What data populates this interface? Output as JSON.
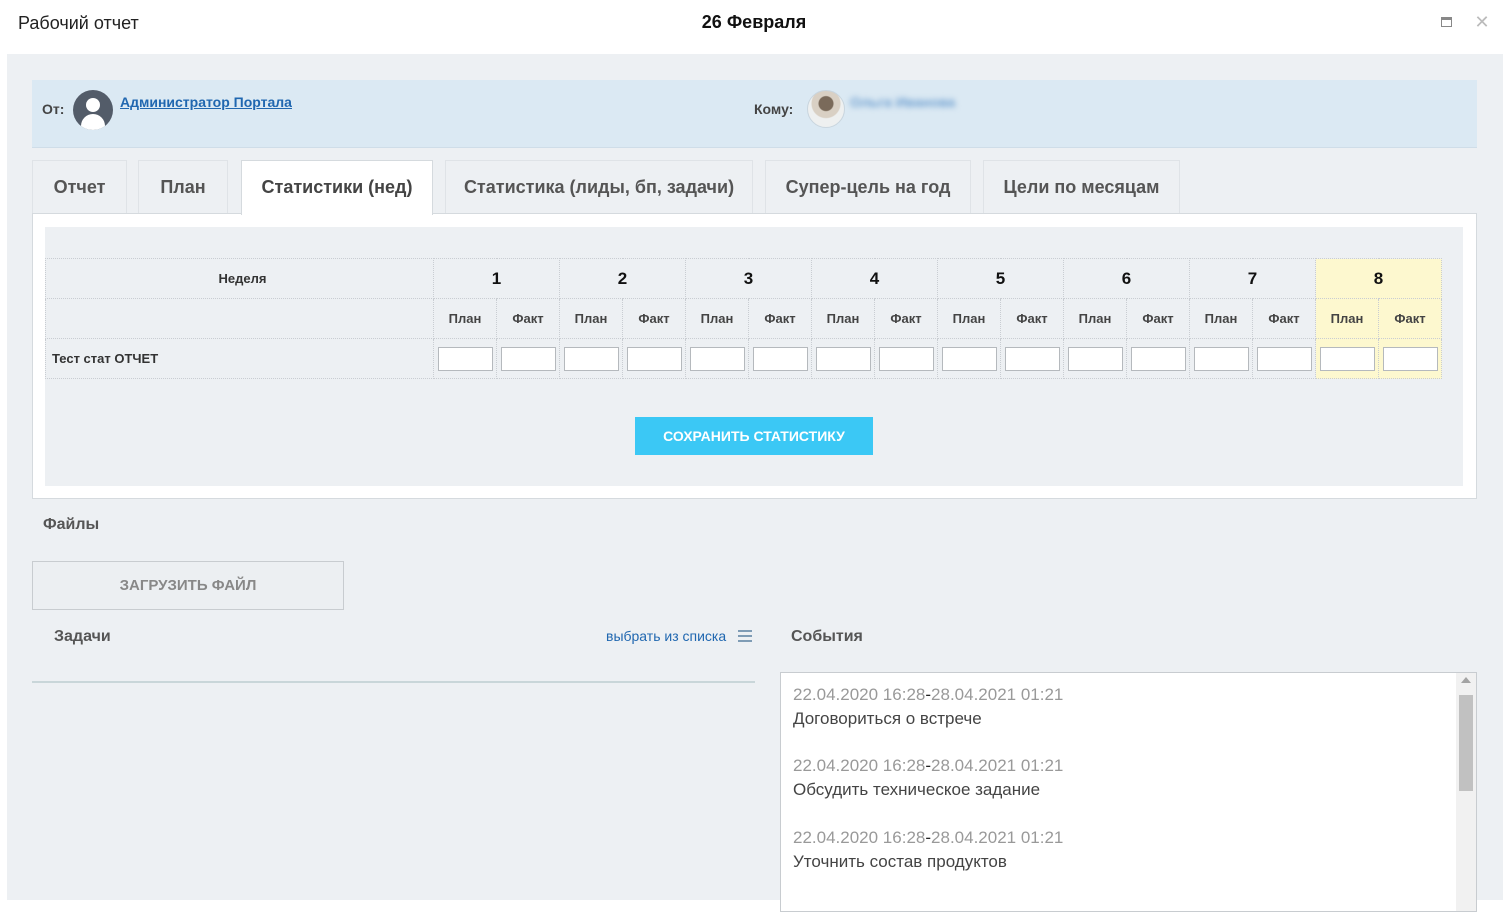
{
  "window": {
    "title": "Рабочий отчет",
    "date": "26 Февраля",
    "maximize_icon": "maximize-icon",
    "close_glyph": "✕"
  },
  "header": {
    "from_label": "От:",
    "from_name": "Администратор Портала",
    "to_label": "Кому:",
    "to_name": "Ольга Иванова"
  },
  "tabs": [
    {
      "label": "Отчет",
      "active": false
    },
    {
      "label": "План",
      "active": false
    },
    {
      "label": "Статистики (нед)",
      "active": true
    },
    {
      "label": "Статистика (лиды, бп, задачи)",
      "active": false
    },
    {
      "label": "Супер-цель на год",
      "active": false
    },
    {
      "label": "Цели по месяцам",
      "active": false
    }
  ],
  "stats": {
    "week_label": "Неделя",
    "weeks": [
      "1",
      "2",
      "3",
      "4",
      "5",
      "6",
      "7",
      "8"
    ],
    "plan_label": "План",
    "fact_label": "Факт",
    "highlighted_week": "8",
    "highlight_color": "#fdf8cf",
    "rows": [
      {
        "name": "Тест стат ОТЧЕТ",
        "values": [
          "",
          "",
          "",
          "",
          "",
          "",
          "",
          "",
          "",
          "",
          "",
          "",
          "",
          "",
          "",
          ""
        ]
      }
    ],
    "save_button": "СОХРАНИТЬ СТАТИСТИКУ",
    "save_button_color": "#3bc8f5"
  },
  "files": {
    "title": "Файлы",
    "upload_button": "ЗАГРУЗИТЬ ФАЙЛ"
  },
  "tasks": {
    "title": "Задачи",
    "pick_link": "выбрать из списка",
    "pick_icon": "list-icon"
  },
  "events": {
    "title": "События",
    "separator": "-",
    "items": [
      {
        "start": "22.04.2020 16:28",
        "end": "28.04.2021 01:21",
        "name": "Договориться о встрече"
      },
      {
        "start": "22.04.2020 16:28",
        "end": "28.04.2021 01:21",
        "name": "Обсудить техническое задание"
      },
      {
        "start": "22.04.2020 16:28",
        "end": "28.04.2021 01:21",
        "name": "Уточнить состав продуктов"
      }
    ]
  }
}
